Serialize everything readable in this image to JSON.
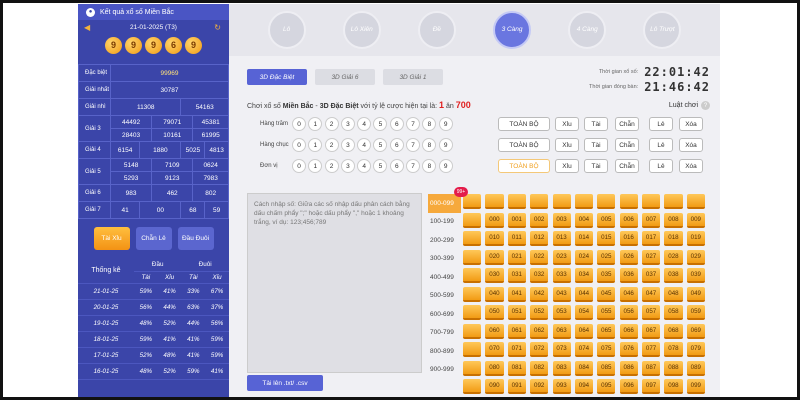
{
  "left": {
    "title": "Kết quả xổ số Miền Bắc",
    "date": "21-01-2025 (T3)",
    "balls": [
      "9",
      "9",
      "9",
      "6",
      "9"
    ],
    "prizes": [
      {
        "label": "Đặc biệt",
        "values": [
          "99969"
        ]
      },
      {
        "label": "Giải nhất",
        "values": [
          "30787"
        ]
      },
      {
        "label": "Giải nhì",
        "values": [
          "11308",
          "54163"
        ]
      },
      {
        "label": "Giải 3",
        "values": [
          "44492",
          "79071",
          "45381",
          "28403",
          "10161",
          "61995"
        ]
      },
      {
        "label": "Giải 4",
        "values": [
          "6154",
          "1880",
          "5025",
          "4813"
        ]
      },
      {
        "label": "Giải 5",
        "values": [
          "5148",
          "7109",
          "0624",
          "5293",
          "9123",
          "7983"
        ]
      },
      {
        "label": "Giải 6",
        "values": [
          "983",
          "462",
          "802"
        ]
      },
      {
        "label": "Giải 7",
        "values": [
          "41",
          "00",
          "68",
          "59"
        ]
      }
    ],
    "stat_tabs": [
      "Tài Xỉu",
      "Chẵn Lẻ",
      "Đầu Đuôi"
    ],
    "stats": {
      "title": "Thống kê",
      "group1": "Đầu",
      "group2": "Đuôi",
      "sub": [
        "Tài",
        "Xỉu",
        "Tài",
        "Xỉu"
      ],
      "rows": [
        [
          "21-01-25",
          "59%",
          "41%",
          "33%",
          "67%"
        ],
        [
          "20-01-25",
          "56%",
          "44%",
          "63%",
          "37%"
        ],
        [
          "19-01-25",
          "48%",
          "52%",
          "44%",
          "56%"
        ],
        [
          "18-01-25",
          "59%",
          "41%",
          "41%",
          "59%"
        ],
        [
          "17-01-25",
          "52%",
          "48%",
          "41%",
          "59%"
        ],
        [
          "16-01-25",
          "48%",
          "52%",
          "59%",
          "41%"
        ]
      ]
    }
  },
  "nav": [
    "Lô",
    "Lô Xiên",
    "Đề",
    "3 Càng",
    "4 Càng",
    "Lô Trượt"
  ],
  "subtabs": [
    "3D Đặc Biệt",
    "3D Giải 6",
    "3D Giải 1"
  ],
  "time": {
    "draw_label": "Thời gian xổ số:",
    "draw": "22:01:42",
    "close_label": "Thời gian đóng bàn:",
    "close": "21:46:42"
  },
  "desc": {
    "pre": "Chơi xổ số ",
    "region": "Miền Bắc",
    "mid": " - ",
    "game": "3D Đặc Biệt",
    "post": " với tỷ lệ cược hiện tại là: ",
    "rate_a": "1",
    "rate_sep": " ăn ",
    "rate_b": "700"
  },
  "rules_label": "Luật chơi",
  "digit_rows": [
    {
      "label": "Hàng trăm"
    },
    {
      "label": "Hàng chục"
    },
    {
      "label": "Đơn vị"
    }
  ],
  "digits": [
    "0",
    "1",
    "2",
    "3",
    "4",
    "5",
    "6",
    "7",
    "8",
    "9"
  ],
  "filters": [
    "TOÀN BỘ",
    "Xỉu",
    "Tài",
    "Chẵn",
    "Lẻ",
    "Xóa"
  ],
  "textarea": "Cách nhập số: Giữa các số nhập dấu phân cách bằng dấu chấm phẩy \";\" hoặc dấu phẩy \",\" hoặc 1 khoảng trắng, ví dụ: 123;456;789",
  "upload": "Tải lên .txt/ .csv",
  "badge": "99+",
  "ranges": [
    "000-099",
    "100-199",
    "200-299",
    "300-399",
    "400-499",
    "500-599",
    "600-699",
    "700-799",
    "800-899",
    "900-999"
  ],
  "grid": [
    [
      "",
      "",
      "",
      "",
      "",
      "",
      "",
      "",
      "",
      "",
      ""
    ],
    [
      "",
      "000",
      "001",
      "002",
      "003",
      "004",
      "005",
      "006",
      "007",
      "008",
      "009"
    ],
    [
      "",
      "010",
      "011",
      "012",
      "013",
      "014",
      "015",
      "016",
      "017",
      "018",
      "019"
    ],
    [
      "",
      "020",
      "021",
      "022",
      "023",
      "024",
      "025",
      "026",
      "027",
      "028",
      "029"
    ],
    [
      "",
      "030",
      "031",
      "032",
      "033",
      "034",
      "035",
      "036",
      "037",
      "038",
      "039"
    ],
    [
      "",
      "040",
      "041",
      "042",
      "043",
      "044",
      "045",
      "046",
      "047",
      "048",
      "049"
    ],
    [
      "",
      "050",
      "051",
      "052",
      "053",
      "054",
      "055",
      "056",
      "057",
      "058",
      "059"
    ],
    [
      "",
      "060",
      "061",
      "062",
      "063",
      "064",
      "065",
      "066",
      "067",
      "068",
      "069"
    ],
    [
      "",
      "070",
      "071",
      "072",
      "073",
      "074",
      "075",
      "076",
      "077",
      "078",
      "079"
    ],
    [
      "",
      "080",
      "081",
      "082",
      "083",
      "084",
      "085",
      "086",
      "087",
      "088",
      "089"
    ],
    [
      "",
      "090",
      "091",
      "092",
      "093",
      "094",
      "095",
      "096",
      "097",
      "098",
      "099"
    ]
  ]
}
